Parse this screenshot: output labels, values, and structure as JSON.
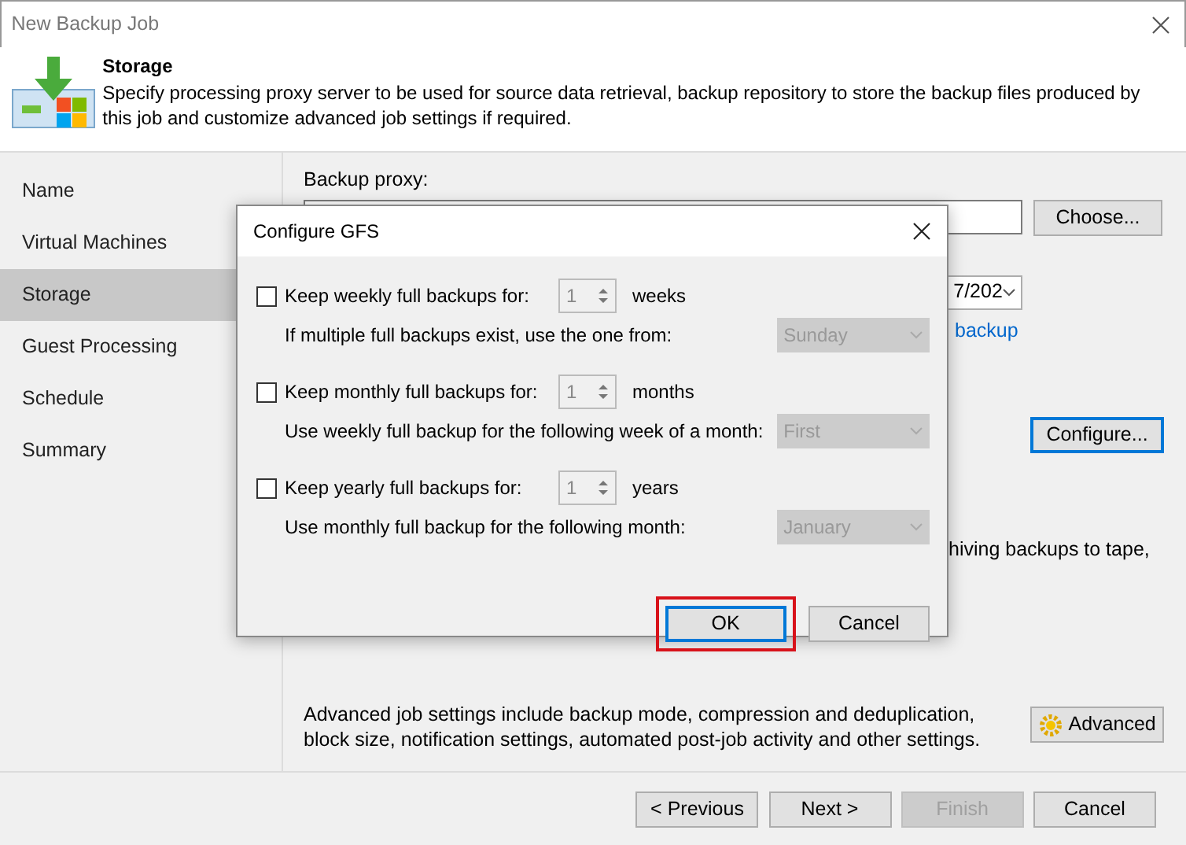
{
  "window": {
    "title": "New Backup Job"
  },
  "header": {
    "title": "Storage",
    "description": "Specify processing proxy server to be used for source data retrieval, backup repository to store the backup files produced by this job and customize advanced job settings if required."
  },
  "steps": [
    {
      "label": "Name",
      "selected": false
    },
    {
      "label": "Virtual Machines",
      "selected": false
    },
    {
      "label": "Storage",
      "selected": true
    },
    {
      "label": "Guest Processing",
      "selected": false
    },
    {
      "label": "Schedule",
      "selected": false
    },
    {
      "label": "Summary",
      "selected": false
    }
  ],
  "content": {
    "proxy_label": "Backup proxy:",
    "choose_button": "Choose...",
    "repository_value": "7/202",
    "link": "backup",
    "configure_button": {
      "label": "Configure...",
      "focused": true
    },
    "tape_text": "hiving backups to tape,",
    "advanced_text": "Advanced job settings include backup mode, compression and deduplication, block size, notification settings, automated post-job activity and other settings.",
    "advanced_button": "Advanced"
  },
  "footer": [
    {
      "label": "< Previous",
      "disabled": false
    },
    {
      "label": "Next >",
      "disabled": false
    },
    {
      "label": "Finish",
      "disabled": true
    },
    {
      "label": "Cancel",
      "disabled": false
    }
  ],
  "dialog": {
    "title": "Configure GFS",
    "rows": [
      {
        "label": "Keep weekly full backups for:",
        "checked": false,
        "value": "1",
        "unit": "weeks",
        "sub_label": "If multiple full backups exist, use the one from:",
        "select_value": "Sunday"
      },
      {
        "label": "Keep monthly full backups for:",
        "checked": false,
        "value": "1",
        "unit": "months",
        "sub_label": "Use weekly full backup for the following week of a month:",
        "select_value": "First"
      },
      {
        "label": "Keep yearly full backups for:",
        "checked": false,
        "value": "1",
        "unit": "years",
        "sub_label": "Use monthly full backup for the following month:",
        "select_value": "January"
      }
    ],
    "ok": {
      "label": "OK",
      "focused": true,
      "highlighted": true
    },
    "cancel": "Cancel"
  }
}
